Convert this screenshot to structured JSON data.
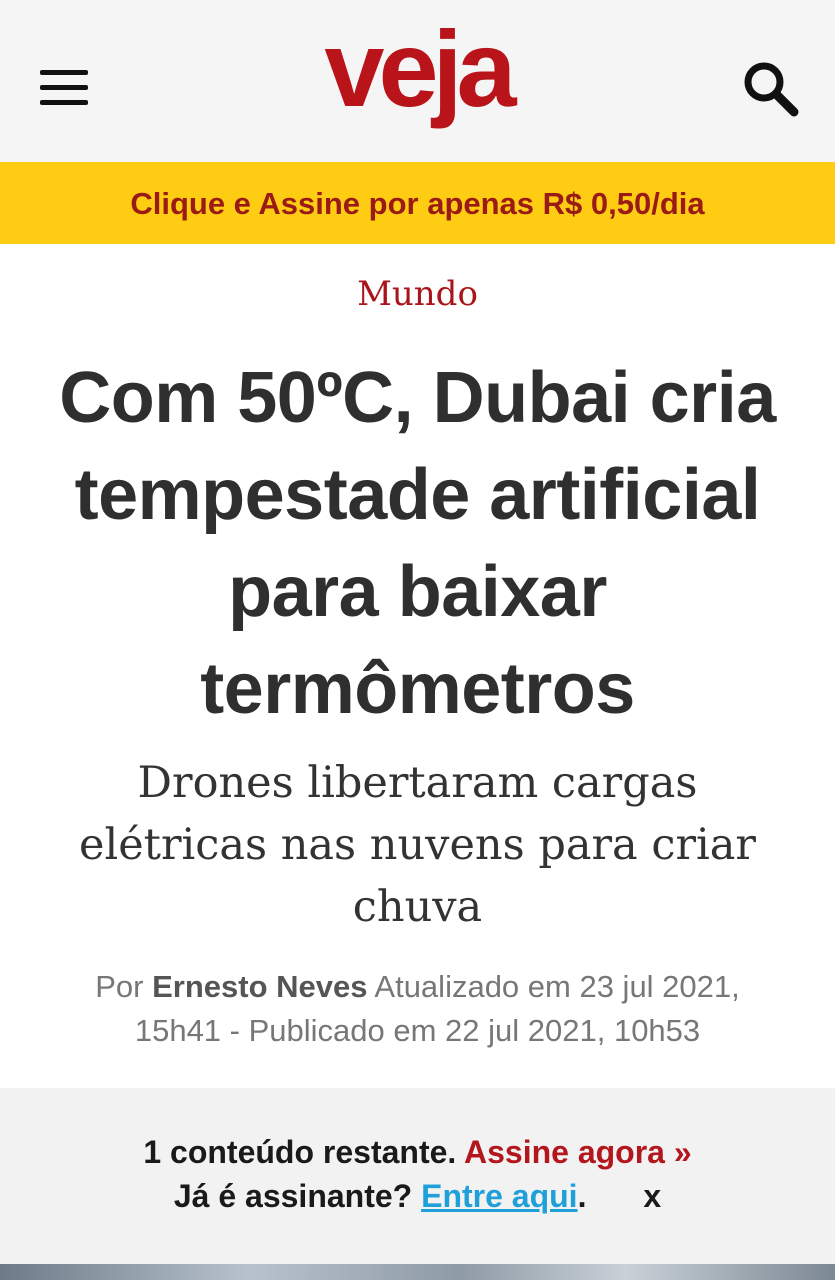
{
  "header": {
    "logo_text": "veja",
    "brand_color": "#b8141a",
    "menu_icon": "hamburger-menu-icon",
    "search_icon": "search-icon"
  },
  "promo": {
    "text": "Clique e Assine por apenas R$ 0,50/dia",
    "background_color": "#ffcc14"
  },
  "article": {
    "category": "Mundo",
    "headline": "Com 50ºC, Dubai cria tempestade artificial para baixar termômetros",
    "subtitle": "Drones libertaram cargas elétricas nas nuvens para criar chuva",
    "byline": {
      "prefix": "Por",
      "author": "Ernesto Neves",
      "dates": "Atualizado em 23 jul 2021, 15h41 - Publicado em 22 jul 2021, 10h53"
    }
  },
  "paywall": {
    "remaining_text": "1 conteúdo restante.",
    "subscribe_link": "Assine agora »",
    "subscriber_question": "Já é assinante?",
    "login_link": "Entre aqui",
    "period": ".",
    "close_label": "x"
  }
}
